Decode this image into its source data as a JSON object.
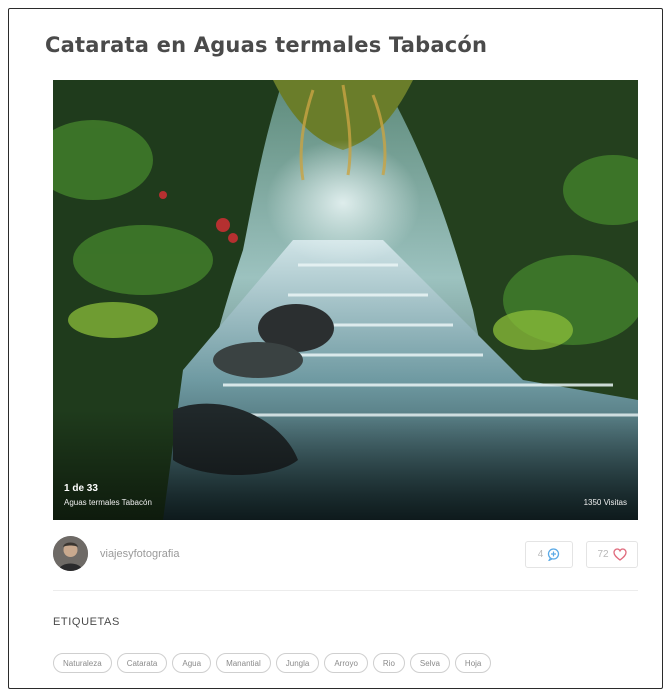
{
  "post": {
    "title": "Catarata en Aguas termales Tabacón"
  },
  "photo": {
    "counter": "1 de 33",
    "caption": "Aguas termales Tabacón",
    "views": "1350 Visitas"
  },
  "author": {
    "name": "viajesyfotografia"
  },
  "stats": {
    "comments": "4",
    "likes": "72",
    "comment_color": "#5aa9e6",
    "like_color": "#e06b7d"
  },
  "tags_section": {
    "heading": "ETIQUETAS",
    "tags": [
      "Naturaleza",
      "Catarata",
      "Agua",
      "Manantial",
      "Jungla",
      "Arroyo",
      "Rio",
      "Selva",
      "Hoja"
    ]
  }
}
